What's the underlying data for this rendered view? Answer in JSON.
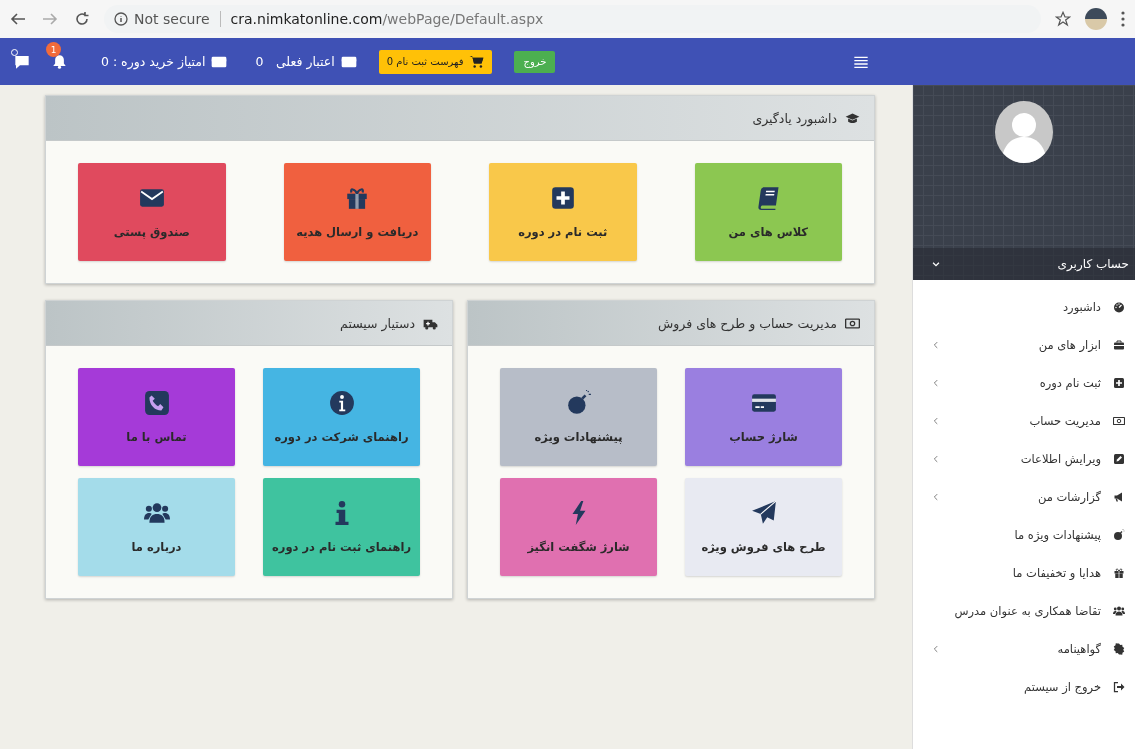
{
  "browser": {
    "security": "Not secure",
    "url_host": "cra.nimkatonline.com",
    "url_path": "/webPage/Default.aspx"
  },
  "top_bar": {
    "notification_count": "1",
    "points_label": "امتیاز خرید دوره :",
    "points_value": "0",
    "credit_label": "اعتبار فعلی",
    "credit_value": "0",
    "cart_label": "فهرست ثبت نام",
    "cart_count": "0",
    "logout": "خروج"
  },
  "profile": {
    "account_label": "حساب کاربری"
  },
  "sidebar": {
    "items": [
      {
        "kind": "gauge",
        "label": "داشبورد",
        "expandable": false
      },
      {
        "kind": "briefcase",
        "label": "ابزار های من",
        "expandable": true
      },
      {
        "kind": "plus",
        "label": "ثبت نام دوره",
        "expandable": true
      },
      {
        "kind": "money",
        "label": "مدیریت حساب",
        "expandable": true
      },
      {
        "kind": "edit",
        "label": "ویرایش اطلاعات",
        "expandable": true
      },
      {
        "kind": "megaphone",
        "label": "گزارشات من",
        "expandable": true
      },
      {
        "kind": "bomb",
        "label": "پیشنهادات ویژه ما",
        "expandable": false
      },
      {
        "kind": "gift",
        "label": "هدایا و تخفیفات ما",
        "expandable": false
      },
      {
        "kind": "users",
        "label": "تقاضا همکاری به عنوان مدرس",
        "expandable": false
      },
      {
        "kind": "certificate",
        "label": "گواهینامه",
        "expandable": true
      },
      {
        "kind": "logout",
        "label": "خروج از سیستم",
        "expandable": false
      }
    ]
  },
  "panels": [
    {
      "kind": "cap",
      "title": "داشبورد یادگیری",
      "tiles": [
        {
          "kind": "book",
          "label": "کلاس های من",
          "color": "#8cc751"
        },
        {
          "kind": "plus",
          "label": "ثبت نام در دوره",
          "color": "#f9c84a"
        },
        {
          "kind": "gift",
          "label": "دریافت و ارسال هدیه",
          "color": "#f0603f"
        },
        {
          "kind": "envelope",
          "label": "صندوق پستی",
          "color": "#e04a5e"
        }
      ]
    },
    {
      "kind": "money",
      "title": "مدیریت حساب و طرح های فروش",
      "tiles": [
        {
          "kind": "card",
          "label": "شارژ حساب",
          "color": "#9a7fe0"
        },
        {
          "kind": "bomb",
          "label": "پیشنهادات ویژه",
          "color": "#b7bdc8"
        },
        {
          "kind": "plane",
          "label": "طرح های فروش ویژه",
          "color": "#e8eaf2"
        },
        {
          "kind": "bolt",
          "label": "شارژ شگفت انگیز",
          "color": "#e070b0"
        }
      ]
    },
    {
      "kind": "truck",
      "title": "دستیار سیستم",
      "tiles": [
        {
          "kind": "info",
          "label": "راهنمای شرکت در دوره",
          "color": "#45b5e3"
        },
        {
          "kind": "phone",
          "label": "تماس با ما",
          "color": "#a53ad8"
        },
        {
          "kind": "info-i",
          "label": "راهنمای ثبت نام در دوره",
          "color": "#3fc39f"
        },
        {
          "kind": "users",
          "label": "درباره ما",
          "color": "#a4dcea"
        }
      ]
    }
  ]
}
